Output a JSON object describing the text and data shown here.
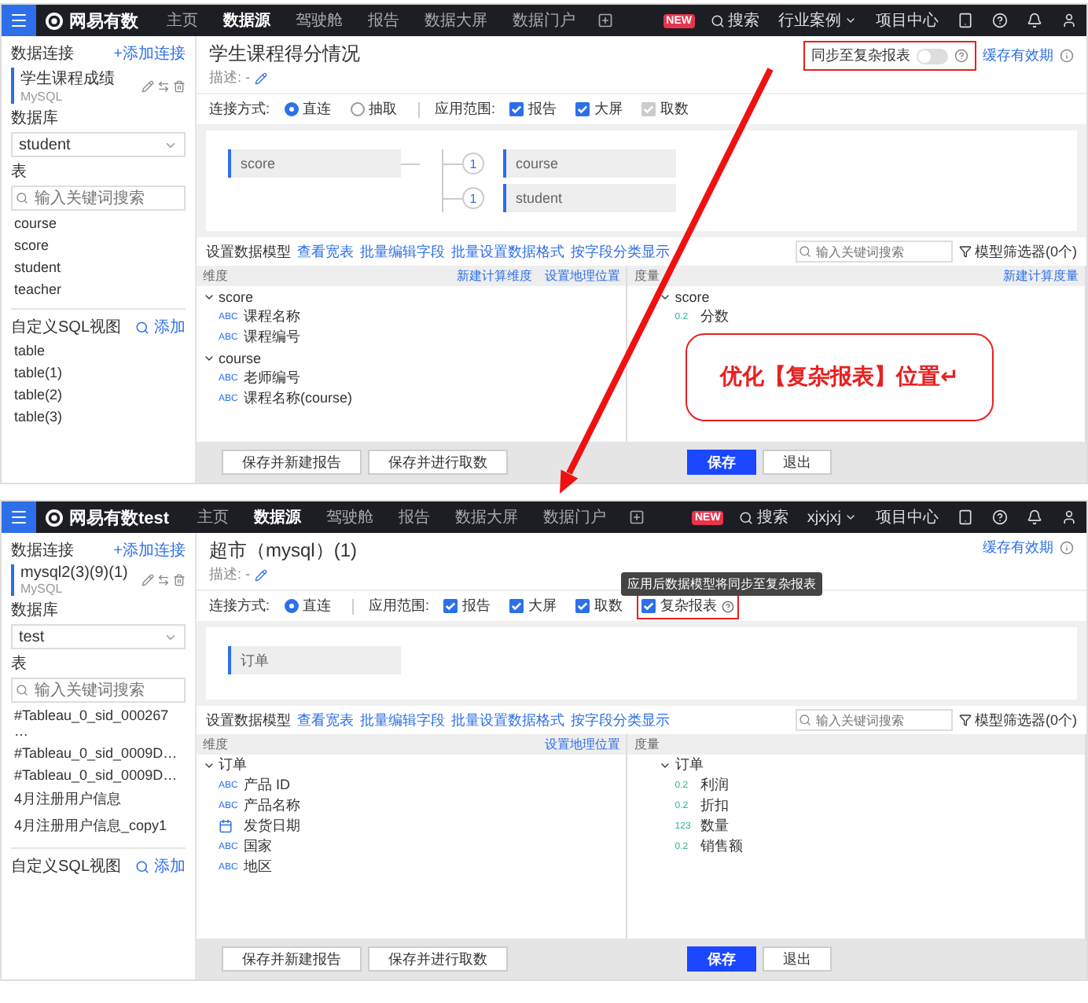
{
  "screens": [
    {
      "topbar": {
        "logo": "网易有数",
        "nav": [
          {
            "label": "主页",
            "selected": false
          },
          {
            "label": "数据源",
            "selected": true
          },
          {
            "label": "驾驶舱",
            "selected": false
          },
          {
            "label": "报告",
            "selected": false
          },
          {
            "label": "数据大屏",
            "selected": false
          },
          {
            "label": "数据门户",
            "selected": false
          }
        ],
        "badge": "NEW",
        "search": "搜索",
        "user_menu": "行业案例",
        "project_center": "项目中心"
      },
      "sidebar": {
        "title": "数据连接",
        "add_connection": "+添加连接",
        "connection": {
          "name": "学生课程成绩",
          "type": "MySQL"
        },
        "database_label": "数据库",
        "database": "student",
        "table_label": "表",
        "table_search": {
          "placeholder": "输入关键词搜索"
        },
        "tables": [
          "course",
          "score",
          "student",
          "teacher"
        ],
        "sql_title": "自定义SQL视图",
        "sql_add": "添加",
        "sql_views": [
          "table",
          "table(1)",
          "table(2)",
          "table(3)"
        ]
      },
      "header": {
        "title": "学生课程得分情况",
        "description": "描述: -",
        "sync": {
          "label": "同步至复杂报表",
          "on": false,
          "highlighted": true
        },
        "cache": "缓存有效期"
      },
      "options": {
        "connect_label": "连接方式:",
        "modes": [
          {
            "label": "直连",
            "selected": true
          },
          {
            "label": "抽取",
            "selected": false
          }
        ],
        "scope_label": "应用范围:",
        "scopes": [
          {
            "label": "报告",
            "checked": true,
            "disabled": false,
            "highlighted": false
          },
          {
            "label": "大屏",
            "checked": true,
            "disabled": false,
            "highlighted": false
          },
          {
            "label": "取数",
            "checked": true,
            "disabled": true,
            "highlighted": false
          }
        ]
      },
      "canvas": {
        "root": "score",
        "joins": [
          {
            "count": "1",
            "table": "course"
          },
          {
            "count": "1",
            "table": "student"
          }
        ]
      },
      "toolbar": {
        "title": "设置数据模型",
        "links": [
          "查看宽表",
          "批量编辑字段",
          "批量设置数据格式",
          "按字段分类显示"
        ],
        "search": {
          "placeholder": "输入关键词搜索"
        },
        "filter": "模型筛选器(0个)"
      },
      "dimensions": {
        "title": "维度",
        "actions": [
          "新建计算维度",
          "设置地理位置"
        ],
        "groups": [
          {
            "name": "score",
            "fields": [
              {
                "kind": "text",
                "tag": "ABC",
                "name": "课程名称"
              },
              {
                "kind": "text",
                "tag": "ABC",
                "name": "课程编号"
              }
            ]
          },
          {
            "name": "course",
            "fields": [
              {
                "kind": "text",
                "tag": "ABC",
                "name": "老师编号"
              },
              {
                "kind": "text",
                "tag": "ABC",
                "name": "课程名称(course)"
              }
            ]
          }
        ]
      },
      "measures": {
        "title": "度量",
        "actions": [
          "新建计算度量"
        ],
        "groups": [
          {
            "name": "score",
            "fields": [
              {
                "kind": "number",
                "tag": "0.2",
                "name": "分数"
              }
            ]
          }
        ]
      },
      "footer": {
        "buttons": [
          {
            "label": "保存并新建报告",
            "kind": "default"
          },
          {
            "label": "保存并进行取数",
            "kind": "default"
          },
          {
            "label": "保存",
            "kind": "primary"
          },
          {
            "label": "退出",
            "kind": "default"
          }
        ]
      }
    },
    {
      "topbar": {
        "logo": "网易有数test",
        "nav": [
          {
            "label": "主页",
            "selected": false
          },
          {
            "label": "数据源",
            "selected": true
          },
          {
            "label": "驾驶舱",
            "selected": false
          },
          {
            "label": "报告",
            "selected": false
          },
          {
            "label": "数据大屏",
            "selected": false
          },
          {
            "label": "数据门户",
            "selected": false
          }
        ],
        "badge": "NEW",
        "search": "搜索",
        "user_menu": "xjxjxj",
        "project_center": "项目中心"
      },
      "sidebar": {
        "title": "数据连接",
        "add_connection": "+添加连接",
        "connection": {
          "name": "mysql2(3)(9)(1)",
          "type": "MySQL"
        },
        "database_label": "数据库",
        "database": "test",
        "table_label": "表",
        "table_search": {
          "placeholder": "输入关键词搜索"
        },
        "tables": [
          "#Tableau_0_sid_000267…",
          "#Tableau_0_sid_0009D…",
          "#Tableau_0_sid_0009D…",
          "4月注册用户信息",
          "4月注册用户信息_copy1"
        ],
        "sql_title": "自定义SQL视图",
        "sql_add": "添加"
      },
      "header": {
        "title": "超市（mysql）(1)",
        "description": "描述: -",
        "cache": "缓存有效期"
      },
      "options": {
        "connect_label": "连接方式:",
        "modes": [
          {
            "label": "直连",
            "selected": true
          }
        ],
        "scope_label": "应用范围:",
        "scopes": [
          {
            "label": "报告",
            "checked": true,
            "disabled": false,
            "highlighted": false
          },
          {
            "label": "大屏",
            "checked": true,
            "disabled": false,
            "highlighted": false
          },
          {
            "label": "取数",
            "checked": true,
            "disabled": false,
            "highlighted": false
          },
          {
            "label": "复杂报表",
            "checked": true,
            "disabled": false,
            "highlighted": true,
            "tooltip": "应用后数据模型将同步至复杂报表"
          }
        ]
      },
      "canvas": {
        "root": "订单"
      },
      "toolbar": {
        "title": "设置数据模型",
        "links": [
          "查看宽表",
          "批量编辑字段",
          "批量设置数据格式",
          "按字段分类显示"
        ],
        "search": {
          "placeholder": "输入关键词搜索"
        },
        "filter": "模型筛选器(0个)"
      },
      "dimensions": {
        "title": "维度",
        "actions": [
          "设置地理位置"
        ],
        "groups": [
          {
            "name": "订单",
            "fields": [
              {
                "kind": "text",
                "tag": "ABC",
                "name": "产品 ID"
              },
              {
                "kind": "text",
                "tag": "ABC",
                "name": "产品名称"
              },
              {
                "kind": "date",
                "name": "发货日期"
              },
              {
                "kind": "text",
                "tag": "ABC",
                "name": "国家"
              },
              {
                "kind": "text",
                "tag": "ABC",
                "name": "地区"
              }
            ]
          }
        ]
      },
      "measures": {
        "title": "度量",
        "groups": [
          {
            "name": "订单",
            "fields": [
              {
                "kind": "number",
                "tag": "0.2",
                "name": "利润"
              },
              {
                "kind": "number",
                "tag": "0.2",
                "name": "折扣"
              },
              {
                "kind": "number",
                "tag": "123",
                "name": "数量"
              },
              {
                "kind": "number",
                "tag": "0.2",
                "name": "销售额"
              }
            ]
          }
        ]
      },
      "footer": {
        "buttons": [
          {
            "label": "保存并新建报告",
            "kind": "default"
          },
          {
            "label": "保存并进行取数",
            "kind": "default"
          },
          {
            "label": "保存",
            "kind": "primary"
          },
          {
            "label": "退出",
            "kind": "default"
          }
        ]
      }
    }
  ],
  "annotation": {
    "text": "优化【复杂报表】位置↵"
  }
}
